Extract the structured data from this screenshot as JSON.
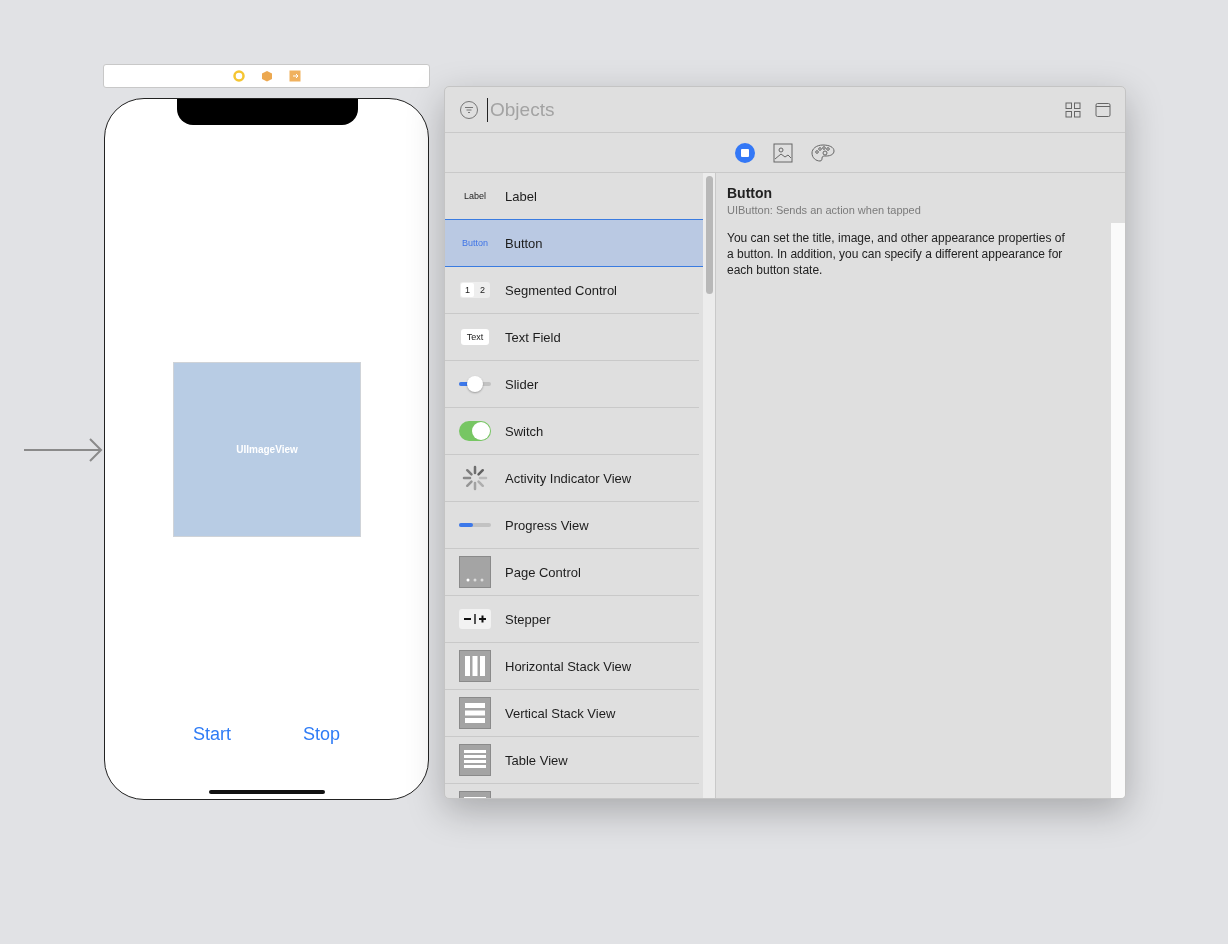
{
  "scene_dock": {
    "icons": [
      {
        "kind": "controller"
      },
      {
        "kind": "first-responder"
      },
      {
        "kind": "exit"
      }
    ]
  },
  "phone": {
    "image_view": {
      "label": "UIImageView"
    },
    "buttons": [
      "Start",
      "Stop"
    ]
  },
  "library": {
    "search": {
      "placeholder": "Objects"
    },
    "scope_tabs": [
      {
        "kind": "objects",
        "selected": true
      },
      {
        "kind": "media",
        "selected": false
      },
      {
        "kind": "colors",
        "selected": false
      }
    ],
    "items": [
      {
        "kind": "label",
        "name": "Label",
        "icon_text": "Label",
        "selected": false
      },
      {
        "kind": "button",
        "name": "Button",
        "icon_text": "Button",
        "selected": true
      },
      {
        "kind": "segmented",
        "name": "Segmented Control",
        "icon_text": [
          "1",
          "2"
        ],
        "selected": false
      },
      {
        "kind": "textfield",
        "name": "Text Field",
        "icon_text": "Text",
        "selected": false
      },
      {
        "kind": "slider",
        "name": "Slider",
        "level": 0.5,
        "selected": false
      },
      {
        "kind": "switch",
        "name": "Switch",
        "on": true,
        "selected": false
      },
      {
        "kind": "activity",
        "name": "Activity Indicator View",
        "selected": false
      },
      {
        "kind": "progress",
        "name": "Progress View",
        "level": 0.45,
        "selected": false
      },
      {
        "kind": "pagecontrol",
        "name": "Page Control",
        "selected": false
      },
      {
        "kind": "stepper",
        "name": "Stepper",
        "selected": false
      },
      {
        "kind": "hstack",
        "name": "Horizontal Stack View",
        "selected": false
      },
      {
        "kind": "vstack",
        "name": "Vertical Stack View",
        "selected": false
      },
      {
        "kind": "table",
        "name": "Table View",
        "selected": false
      },
      {
        "kind": "table",
        "selected": false
      }
    ],
    "detail": {
      "title": "Button",
      "subtitle": "UIButton: Sends an action when tapped",
      "description": "You can set the title, image, and other appearance properties of a button. In addition, you can specify a different appearance for each button state."
    }
  }
}
